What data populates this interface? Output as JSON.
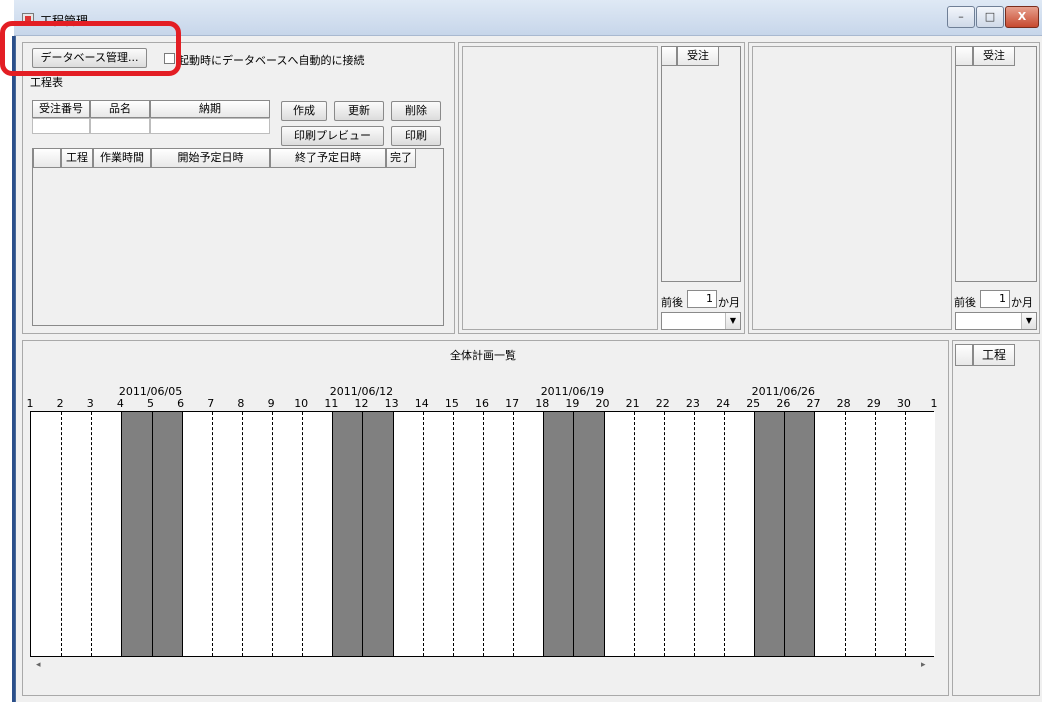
{
  "window": {
    "title": "工程管理",
    "controls": [
      "–",
      "□",
      "X"
    ]
  },
  "toolbar": {
    "db_button": "データベース管理...",
    "auto_connect_label": "起動時にデータベースへ自動的に接続"
  },
  "left_panel": {
    "section_label": "工程表",
    "order_table": {
      "headers": [
        "受注番号",
        "品名",
        "納期"
      ]
    },
    "buttons": {
      "create": "作成",
      "update": "更新",
      "delete": "削除",
      "print_preview": "印刷プレビュー",
      "print": "印刷"
    },
    "process_table": {
      "headers": [
        "",
        "工程",
        "作業時間",
        "開始予定日時",
        "終了予定日時",
        "完了"
      ]
    }
  },
  "middle_panel": {
    "list_header": "受注",
    "range_label_prefix": "前後",
    "range_value": "1",
    "range_label_suffix": "か月"
  },
  "right_panel": {
    "list_header": "受注",
    "range_label_prefix": "前後",
    "range_value": "1",
    "range_label_suffix": "か月"
  },
  "overview": {
    "title": "全体計画一覧",
    "side_header": "工程",
    "days": [
      "1",
      "2",
      "3",
      "4",
      "5",
      "6",
      "7",
      "8",
      "9",
      "10",
      "11",
      "12",
      "13",
      "14",
      "15",
      "16",
      "17",
      "18",
      "19",
      "20",
      "21",
      "22",
      "23",
      "24",
      "25",
      "26",
      "27",
      "28",
      "29",
      "30",
      "1"
    ],
    "week_dates": [
      "2011/06/05",
      "2011/06/12",
      "2011/06/19",
      "2011/06/26"
    ],
    "scroll_left": "◂",
    "scroll_right": "▸",
    "colors": {
      "weekend": "#808080",
      "weekday": "#ffffff",
      "highlight": "#e31e24"
    }
  }
}
